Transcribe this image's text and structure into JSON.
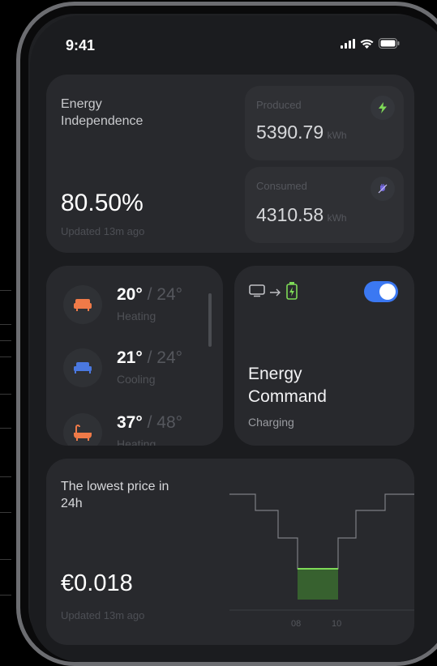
{
  "status_bar": {
    "time": "9:41"
  },
  "energy": {
    "title": "Energy Independence",
    "percentage": "80.50%",
    "updated": "Updated 13m ago",
    "produced": {
      "label": "Produced",
      "value": "5390.79",
      "unit": "kWh"
    },
    "consumed": {
      "label": "Consumed",
      "value": "4310.58",
      "unit": "kWh"
    }
  },
  "rooms": [
    {
      "temp": "20°",
      "target": " / 24°",
      "mode": "Heating",
      "color": "#ef7a48"
    },
    {
      "temp": "21°",
      "target": " / 24°",
      "mode": "Cooling",
      "color": "#4a78e0"
    },
    {
      "temp": "37°",
      "target": " / 48°",
      "mode": "Heating",
      "color": "#ef7a48"
    }
  ],
  "command": {
    "title": "Energy Command",
    "status": "Charging",
    "toggle_on": true
  },
  "price": {
    "title": "The lowest price in 24h",
    "value": "€0.018",
    "updated": "Updated 13m ago",
    "axis_labels": [
      "08",
      "10"
    ]
  },
  "colors": {
    "accent": "#3b78f2",
    "green": "#7ed957",
    "orange": "#ef7a48",
    "blue": "#4a78e0"
  }
}
